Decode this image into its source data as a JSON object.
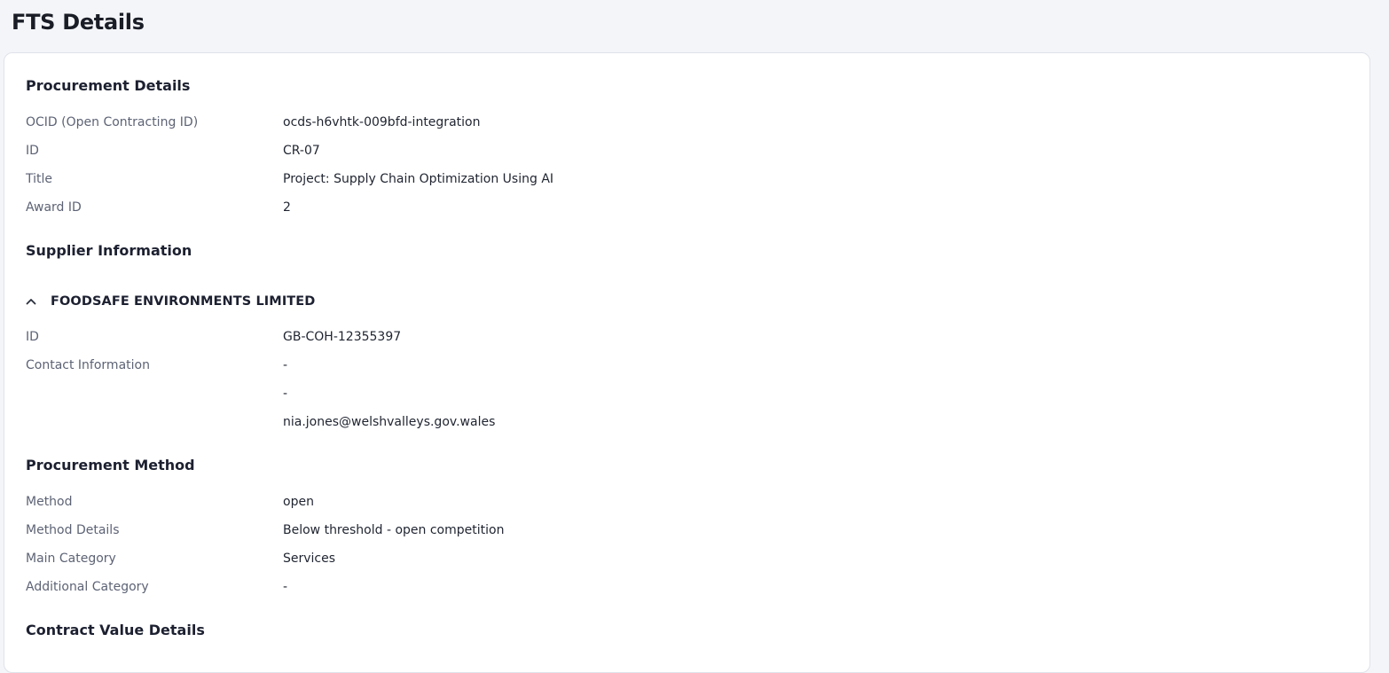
{
  "page": {
    "title": "FTS Details"
  },
  "procurement_details": {
    "heading": "Procurement Details",
    "rows": [
      {
        "label": "OCID (Open Contracting ID)",
        "value": "ocds-h6vhtk-009bfd-integration"
      },
      {
        "label": "ID",
        "value": "CR-07"
      },
      {
        "label": "Title",
        "value": "Project: Supply Chain Optimization Using AI"
      },
      {
        "label": "Award ID",
        "value": "2"
      }
    ]
  },
  "supplier_information": {
    "heading": "Supplier Information",
    "supplier": {
      "name": "FOODSAFE ENVIRONMENTS LIMITED",
      "expanded": true,
      "id_label": "ID",
      "id_value": "GB-COH-12355397",
      "contact_label": "Contact Information",
      "contact_lines": [
        "-",
        "-",
        "nia.jones@welshvalleys.gov.wales"
      ]
    }
  },
  "procurement_method": {
    "heading": "Procurement Method",
    "rows": [
      {
        "label": "Method",
        "value": "open"
      },
      {
        "label": "Method Details",
        "value": "Below threshold - open competition"
      },
      {
        "label": "Main Category",
        "value": "Services"
      },
      {
        "label": "Additional Category",
        "value": "-"
      }
    ]
  },
  "contract_value_details": {
    "heading": "Contract Value Details"
  },
  "icons": {
    "supplier_toggle": "chevron-up-icon"
  }
}
